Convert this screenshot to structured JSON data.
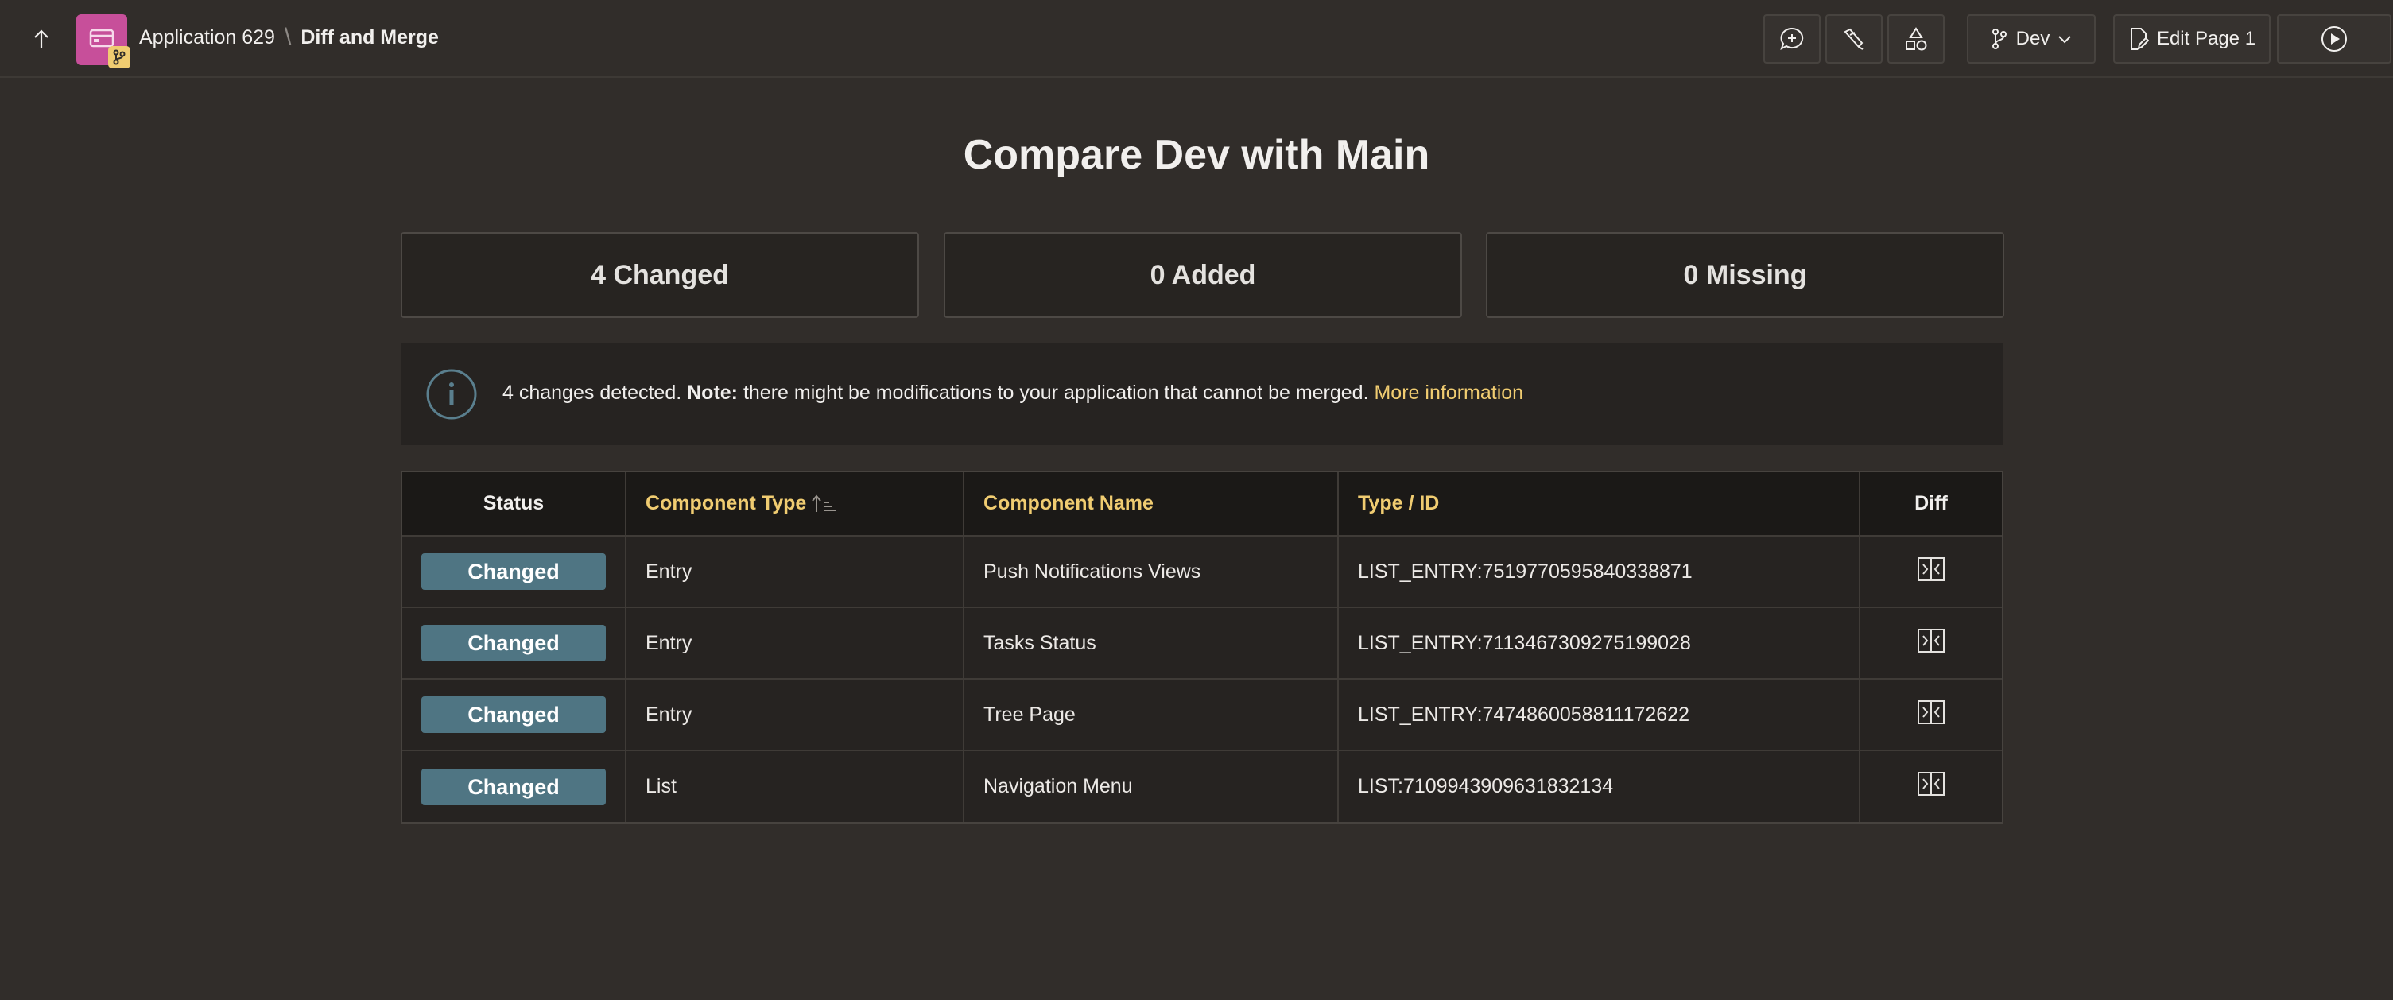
{
  "header": {
    "app_name": "Application 629",
    "page_name": "Diff and Merge",
    "branch_label": "Dev",
    "edit_label": "Edit Page 1"
  },
  "page": {
    "title": "Compare Dev with Main"
  },
  "stats": {
    "changed": "4 Changed",
    "added": "0 Added",
    "missing": "0 Missing"
  },
  "info": {
    "lead": "4 changes detected. ",
    "note_label": "Note:",
    "note_text": " there might be modifications to your application that cannot be merged. ",
    "link": "More information"
  },
  "table": {
    "columns": [
      "Status",
      "Component Type",
      "Component Name",
      "Type / ID",
      "Diff"
    ],
    "rows": [
      {
        "status": "Changed",
        "type": "Entry",
        "name": "Push Notifications Views",
        "id": "LIST_ENTRY:7519770595840338871"
      },
      {
        "status": "Changed",
        "type": "Entry",
        "name": "Tasks Status",
        "id": "LIST_ENTRY:7113467309275199028"
      },
      {
        "status": "Changed",
        "type": "Entry",
        "name": "Tree Page",
        "id": "LIST_ENTRY:7474860058811172622"
      },
      {
        "status": "Changed",
        "type": "List",
        "name": "Navigation Menu",
        "id": "LIST:7109943909631832134"
      }
    ]
  },
  "colors": {
    "background": "#312d2a",
    "accent": "#f0cc71",
    "status_badge": "#4f7583",
    "app_icon": "#c74f9a"
  },
  "icons": {
    "up": "arrow-up-icon",
    "comment": "add-comment-icon",
    "wrench": "tools-icon",
    "shapes": "shared-components-icon",
    "branch": "branch-icon",
    "edit": "edit-page-icon",
    "run": "run-page-icon",
    "diff": "diff-compare-icon"
  }
}
